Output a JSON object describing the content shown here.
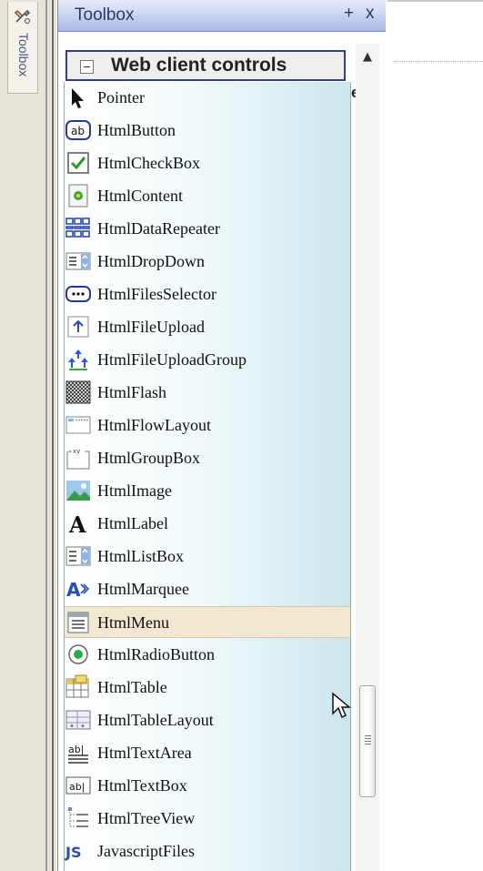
{
  "side_tab": {
    "label": "Toolbox",
    "icon": "toolbox-icon"
  },
  "toolbox": {
    "title": "Toolbox",
    "pin_label": "+",
    "close_label": "x",
    "group": {
      "label": "Web client controls",
      "toggle": "−"
    },
    "hidden_tab_text": "es",
    "items": [
      {
        "label": "Pointer",
        "icon": "pointer-arrow-icon"
      },
      {
        "label": "HtmlButton",
        "icon": "button-ab-icon"
      },
      {
        "label": "HtmlCheckBox",
        "icon": "checkbox-icon"
      },
      {
        "label": "HtmlContent",
        "icon": "content-page-icon"
      },
      {
        "label": "HtmlDataRepeater",
        "icon": "data-repeater-icon"
      },
      {
        "label": "HtmlDropDown",
        "icon": "dropdown-icon"
      },
      {
        "label": "HtmlFilesSelector",
        "icon": "files-selector-icon"
      },
      {
        "label": "HtmlFileUpload",
        "icon": "file-upload-icon"
      },
      {
        "label": "HtmlFileUploadGroup",
        "icon": "file-upload-group-icon"
      },
      {
        "label": "HtmlFlash",
        "icon": "flash-icon"
      },
      {
        "label": "HtmlFlowLayout",
        "icon": "flow-layout-icon"
      },
      {
        "label": "HtmlGroupBox",
        "icon": "group-box-icon"
      },
      {
        "label": "HtmlImage",
        "icon": "image-icon"
      },
      {
        "label": "HtmlLabel",
        "icon": "label-a-icon"
      },
      {
        "label": "HtmlListBox",
        "icon": "list-box-icon"
      },
      {
        "label": "HtmlMarquee",
        "icon": "marquee-icon"
      },
      {
        "label": "HtmlMenu",
        "icon": "menu-icon"
      },
      {
        "label": "HtmlRadioButton",
        "icon": "radio-button-icon"
      },
      {
        "label": "HtmlTable",
        "icon": "table-icon"
      },
      {
        "label": "HtmlTableLayout",
        "icon": "table-layout-icon"
      },
      {
        "label": "HtmlTextArea",
        "icon": "text-area-icon"
      },
      {
        "label": "HtmlTextBox",
        "icon": "text-box-icon"
      },
      {
        "label": "HtmlTreeView",
        "icon": "tree-view-icon"
      },
      {
        "label": "JavascriptFiles",
        "icon": "javascript-files-icon"
      }
    ],
    "selected_item": "HtmlMenu"
  },
  "colors": {
    "title_bar": "#c2cff0",
    "group_border": "#2e3f86",
    "list_gradient_end": "#cbe6ec",
    "selected_row": "#f2e8d2"
  }
}
